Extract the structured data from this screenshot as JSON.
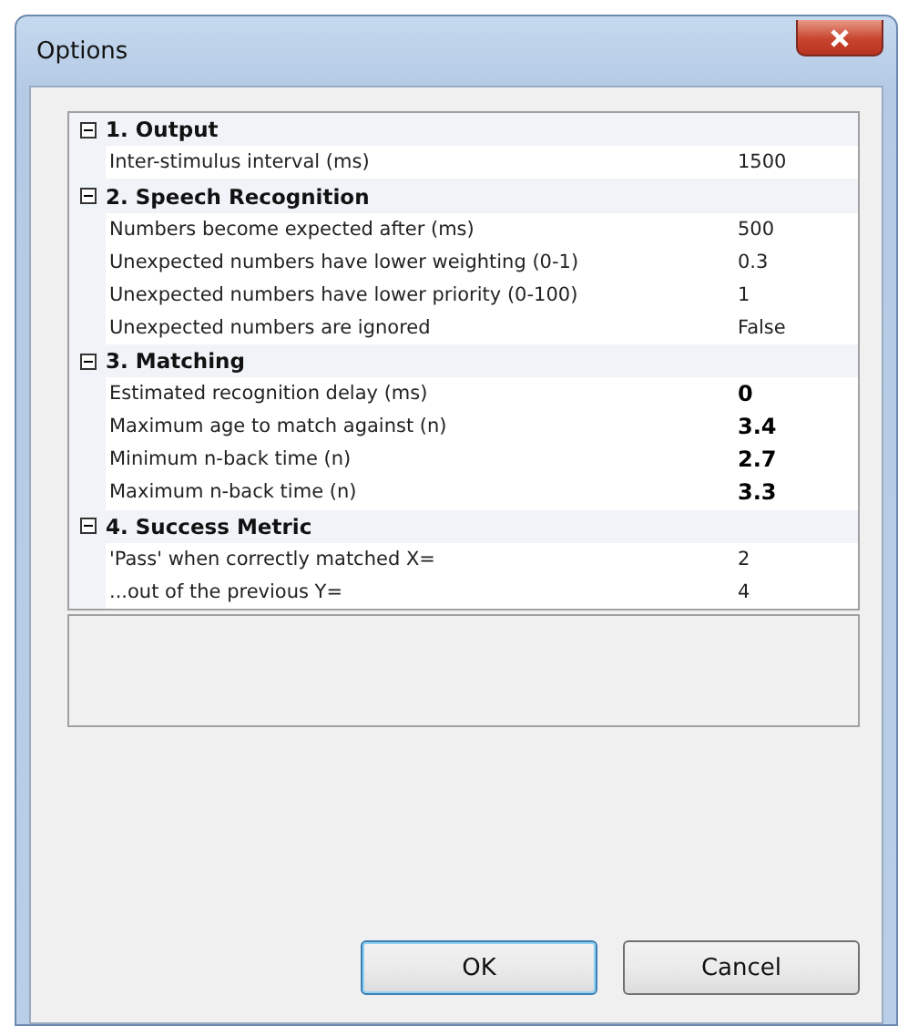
{
  "window": {
    "title": "Options"
  },
  "sections": [
    {
      "title": "1. Output",
      "expanded": true,
      "properties": [
        {
          "name": "Inter-stimulus interval (ms)",
          "value": "1500",
          "modified": false
        }
      ]
    },
    {
      "title": "2. Speech Recognition",
      "expanded": true,
      "properties": [
        {
          "name": "Numbers become expected after (ms)",
          "value": "500",
          "modified": false
        },
        {
          "name": "Unexpected numbers have lower weighting (0-1)",
          "value": "0.3",
          "modified": false
        },
        {
          "name": "Unexpected numbers have lower priority (0-100)",
          "value": "1",
          "modified": false
        },
        {
          "name": "Unexpected numbers are ignored",
          "value": "False",
          "modified": false
        }
      ]
    },
    {
      "title": "3. Matching",
      "expanded": true,
      "properties": [
        {
          "name": "Estimated recognition delay (ms)",
          "value": "0",
          "modified": true
        },
        {
          "name": "Maximum age to match against (n)",
          "value": "3.4",
          "modified": true
        },
        {
          "name": "Minimum n-back time (n)",
          "value": "2.7",
          "modified": true
        },
        {
          "name": "Maximum n-back time (n)",
          "value": "3.3",
          "modified": true
        }
      ]
    },
    {
      "title": "4. Success Metric",
      "expanded": true,
      "properties": [
        {
          "name": "'Pass' when correctly matched X=",
          "value": "2",
          "modified": false
        },
        {
          "name": "...out of the previous Y=",
          "value": "4",
          "modified": false
        }
      ]
    }
  ],
  "buttons": [
    {
      "label": "OK",
      "default": true
    },
    {
      "label": "Cancel",
      "default": false
    }
  ]
}
